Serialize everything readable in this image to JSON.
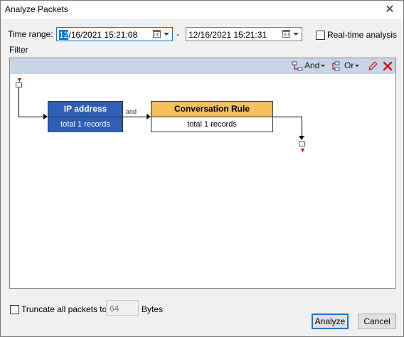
{
  "window": {
    "title": "Analyze Packets"
  },
  "time_range": {
    "label": "Time range:",
    "start_selected": "12",
    "start_rest": "/16/2021 15:21:08",
    "separator": "-",
    "end": "12/16/2021 15:21:31"
  },
  "realtime": {
    "label": "Real-time analysis",
    "checked": false
  },
  "filter": {
    "label": "Filter",
    "toolbar": {
      "and_label": "And",
      "or_label": "Or"
    },
    "nodes": [
      {
        "title": "IP address",
        "records": "total 1 records",
        "color": "#2f5eb7"
      },
      {
        "title": "Conversation Rule",
        "records": "total 1 records",
        "color": "#f5c05c"
      }
    ],
    "connector_label": "and"
  },
  "truncate": {
    "label": "Truncate all packets to:",
    "checked": false,
    "value": "64",
    "unit": "Bytes"
  },
  "buttons": {
    "analyze": "Analyze",
    "cancel": "Cancel"
  }
}
